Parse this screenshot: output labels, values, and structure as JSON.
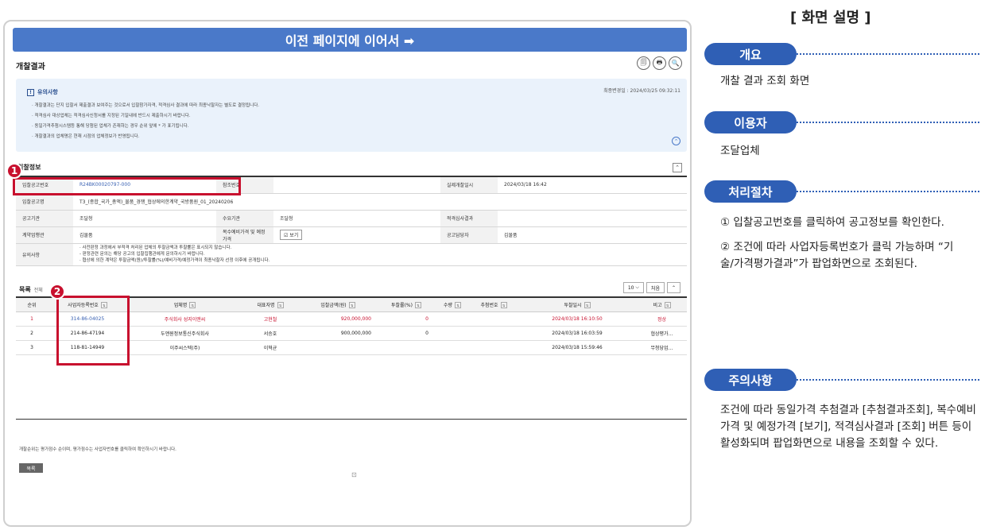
{
  "banner": "이전 페이지에 이어서 ➡",
  "page_title": "개찰결과",
  "toolbar": {
    "icon1": "🗐",
    "icon2": "🖶",
    "icon3": "🔍"
  },
  "notice": {
    "title": "유의사항",
    "updated": "최종변경일 : 2024/03/25 09:32:11",
    "items": [
      "개찰결과는 단지 입찰서 제출결과 보여주는 것으로서 입찰참가자격, 적격심사 결과에 따라 최종낙찰자는 별도로 결정됩니다.",
      "적격심사 대상업체는 적격심사신청서를 지정된 기일내에 반드시 제출하시기 바랍니다.",
      "동일가격추첨시스템등 통해 당첨된 업체가 존재하는 경우 순위 앞에 * 가 표기됩니다.",
      "개찰결과의 업체명은 현재 시점의 업체정보가 반영됩니다."
    ]
  },
  "bid_info": {
    "section": "입찰정보",
    "rows": [
      [
        {
          "l": "입찰공고번호",
          "v": "R24BK00020797-000"
        },
        {
          "l": "참조번호",
          "v": ""
        },
        {
          "l": "실제개찰일시",
          "v": "2024/03/18 16:42"
        }
      ],
      [
        {
          "l": "입찰공고명",
          "v": "T3_(종합_국가_총액)_물품_경쟁_협상에의한계약_국방품원_01_20240206"
        }
      ],
      [
        {
          "l": "공고기관",
          "v": "조달청"
        },
        {
          "l": "수요기관",
          "v": "조달청"
        },
        {
          "l": "적격심사결과",
          "v": ""
        }
      ],
      [
        {
          "l": "계약업행관",
          "v": "김물품"
        },
        {
          "l": "복수예비가격 및 예정가격",
          "v": "보기"
        },
        {
          "l": "공고담당자",
          "v": "김물품"
        }
      ],
      [
        {
          "l": "유의사항",
          "v": "· 사전판정 과정에서 부적격 처리된 업체의 투찰금액과 투찰률은 표시되지 않습니다.\n- 판정관련 문의는 해당 공고의 입찰집행관에게 문의하시기 바랍니다.\n· 협상에 의한 계약은 투찰금액(원)/투찰률(%)/예비가격/예정가격이 최종낙찰자 선정 이후에 공개됩니다."
        }
      ]
    ]
  },
  "list": {
    "section": "목록",
    "total": "전체",
    "page_size": "10",
    "search_label": "처음",
    "headers": [
      "순위",
      "사업자등록번호",
      "업체명",
      "대표자명",
      "입찰금액(원)",
      "투찰률(%)",
      "추첨번호",
      "수량",
      "투찰일시",
      "비고"
    ],
    "rows": [
      [
        "1",
        "314-86-04025",
        "주식회사 성지이앤씨",
        "고현철",
        "920,000,000",
        "0",
        "",
        "",
        "2024/03/18 16:10:50",
        "정상"
      ],
      [
        "2",
        "214-86-47194",
        "두앤원정보통신주식회사",
        "서승호",
        "900,000,000",
        "0",
        "",
        "",
        "2024/03/18 16:03:59",
        "협상평가…"
      ],
      [
        "3",
        "118-81-14949",
        "이주씨스텍(주)",
        "이혁균",
        "",
        "",
        "",
        "",
        "2024/03/18 15:59:46",
        "무청당업…"
      ]
    ]
  },
  "footnote": "개찰순위는 평가점수 순이며, 평가점수는 사업자번호를 클릭하여 확인하시기 바랍니다.",
  "list_button": "목록",
  "callouts": [
    "1",
    "2"
  ],
  "right": {
    "title": "[ 화면 설명 ]",
    "s1": "개요",
    "s1_text": "개찰 결과 조회 화면",
    "s2": "이용자",
    "s2_text": "조달업체",
    "s3": "처리절차",
    "steps": [
      "① 입찰공고번호를 클릭하여 공고정보를 확인한다.",
      "② 조건에 따라 사업자등록번호가 클릭 가능하며 “기술/가격평가결과”가 팝업화면으로 조회된다."
    ],
    "s4": "주의사항",
    "s4_text": "조건에 따라 동일가격 추첨결과 [추첨결과조회], 복수예비가격 및 예정가격 [보기], 적격심사결과 [조회] 버튼 등이 활성화되며 팝업화면으로 내용을 조회할 수 있다."
  }
}
